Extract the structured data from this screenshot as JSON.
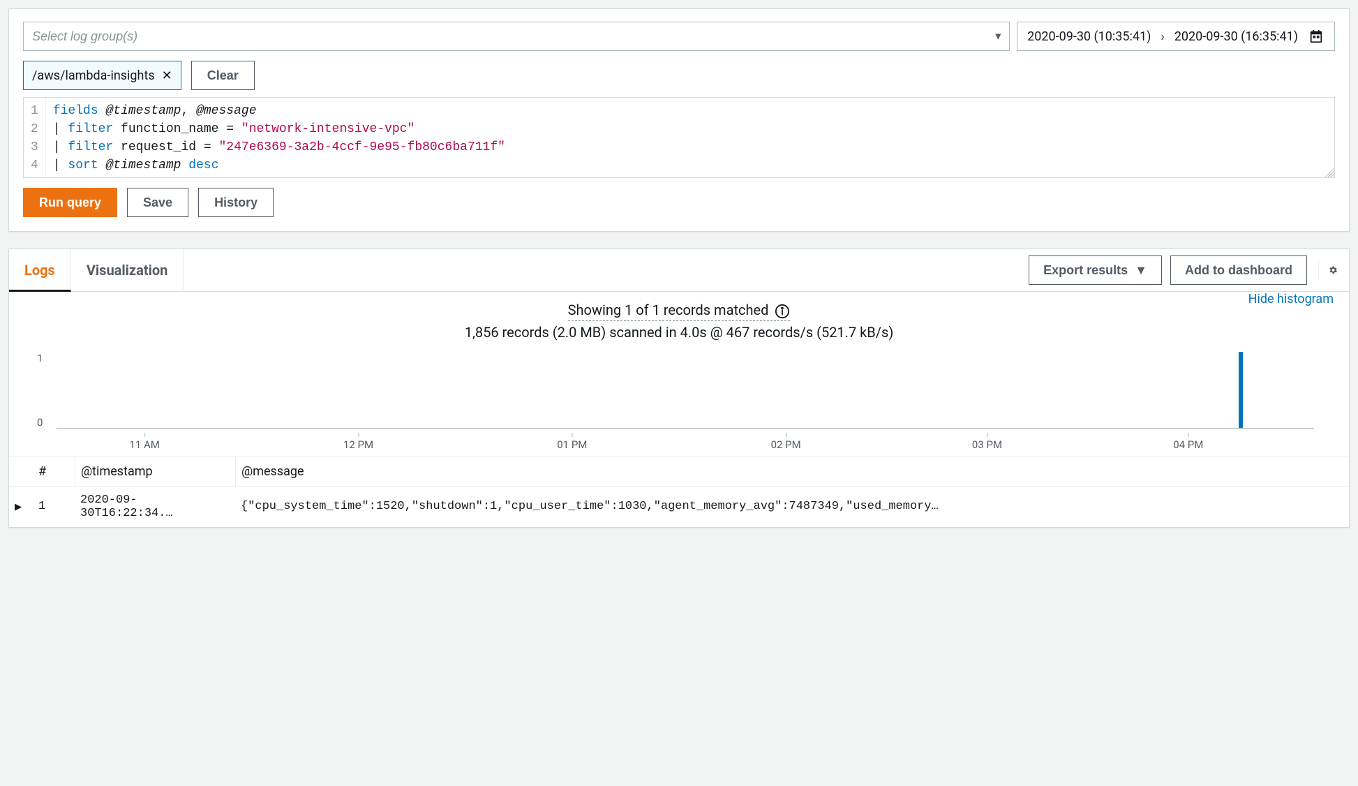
{
  "topbar": {
    "select_placeholder": "Select log group(s)",
    "date_from": "2020-09-30 (10:35:41)",
    "date_to": "2020-09-30 (16:35:41)"
  },
  "tags": {
    "selected": "/aws/lambda-insights",
    "clear_label": "Clear"
  },
  "editor": {
    "lines": [
      "1",
      "2",
      "3",
      "4"
    ],
    "l1_kw": "fields",
    "l1_f1": "@timestamp",
    "l1_sep": ", ",
    "l1_f2": "@message",
    "l2_kw": "filter",
    "l2_lhs": "function_name",
    "l2_eq": " = ",
    "l2_str": "\"network-intensive-vpc\"",
    "l3_kw": "filter",
    "l3_lhs": "request_id",
    "l3_eq": " = ",
    "l3_str": "\"247e6369-3a2b-4ccf-9e95-fb80c6ba711f\"",
    "l4_kw": "sort",
    "l4_f": "@timestamp",
    "l4_dir": "desc"
  },
  "actions": {
    "run": "Run query",
    "save": "Save",
    "history": "History"
  },
  "results": {
    "tabs": {
      "logs": "Logs",
      "viz": "Visualization"
    },
    "export": "Export results",
    "add_dash": "Add to dashboard",
    "hide_histogram": "Hide histogram",
    "summary_line1": "Showing 1 of 1 records matched",
    "summary_line2": "1,856 records (2.0 MB) scanned in 4.0s @ 467 records/s (521.7 kB/s)",
    "y_ticks": [
      "1",
      "0"
    ],
    "x_ticks": [
      "11 AM",
      "12 PM",
      "01 PM",
      "02 PM",
      "03 PM",
      "04 PM"
    ],
    "header": {
      "idx": "#",
      "ts": "@timestamp",
      "msg": "@message"
    },
    "rows": [
      {
        "idx": "1",
        "ts": "2020-09-30T16:22:34.…",
        "msg": "{\"cpu_system_time\":1520,\"shutdown\":1,\"cpu_user_time\":1030,\"agent_memory_avg\":7487349,\"used_memory…"
      }
    ]
  },
  "chart_data": {
    "type": "bar",
    "categories": [
      "11 AM",
      "12 PM",
      "01 PM",
      "02 PM",
      "03 PM",
      "04 PM"
    ],
    "bars": [
      {
        "x_pct": 94,
        "value": 1
      }
    ],
    "ylim": [
      0,
      1
    ],
    "xlabel": "",
    "ylabel": ""
  }
}
